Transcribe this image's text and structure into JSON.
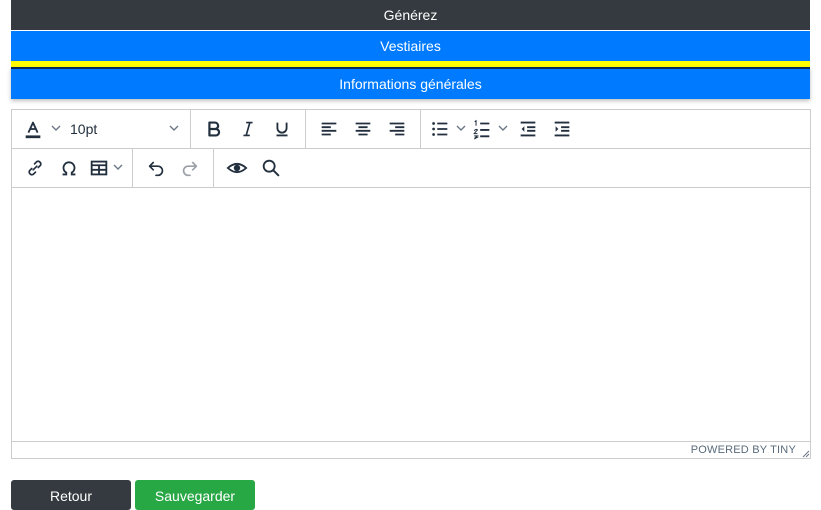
{
  "nav": {
    "generate_label": "Générez",
    "lockers_label": "Vestiaires",
    "general_info_label": "Informations générales"
  },
  "toolbar": {
    "font_size_value": "10pt"
  },
  "statusbar": {
    "branding": "POWERED BY TINY"
  },
  "actions": {
    "back_label": "Retour",
    "save_label": "Sauvegarder"
  },
  "colors": {
    "dark": "#343a40",
    "primary": "#007bff",
    "accent_yellow": "#ffff00",
    "success": "#28a745"
  }
}
